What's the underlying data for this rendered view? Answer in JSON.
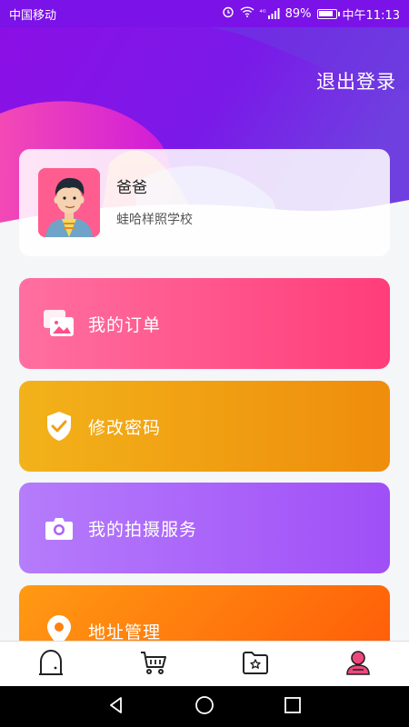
{
  "status_bar": {
    "carrier": "中国移动",
    "signal_label": "⁴ᴳ",
    "battery_percent": "89%",
    "time": "中午11:13"
  },
  "header": {
    "logout_label": "退出登录"
  },
  "profile": {
    "name": "爸爸",
    "school": "蛙哈样照学校"
  },
  "menu": {
    "orders_label": "我的订单",
    "password_label": "修改密码",
    "photo_service_label": "我的拍摄服务",
    "address_label": "地址管理"
  },
  "colors": {
    "header_purple": "#7b12e8",
    "orders": "#ff3d7a",
    "password": "#ef8d0c",
    "photo_service": "#a04ff7",
    "address": "#ff5a08",
    "tab_active": "#f0467e"
  },
  "tabs": [
    {
      "icon": "home-arch-icon"
    },
    {
      "icon": "cart-icon"
    },
    {
      "icon": "star-folder-icon"
    },
    {
      "icon": "profile-icon",
      "active": true
    }
  ]
}
